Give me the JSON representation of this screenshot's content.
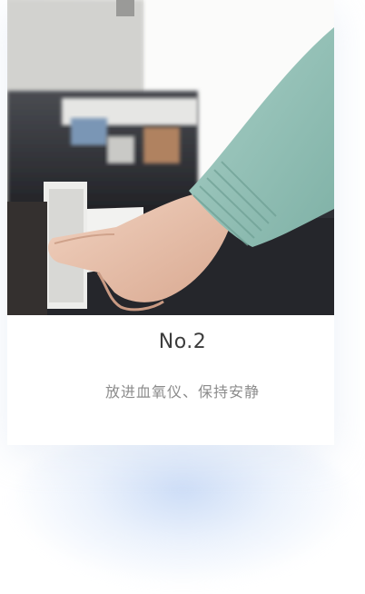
{
  "step": {
    "number_label": "No.2",
    "description": "放进血氧仪、保持安静"
  },
  "photo": {
    "subject": "finger-inserted-into-pulse-oximeter-icon"
  },
  "colors": {
    "title": "#3c3c3c",
    "subtitle": "#8c8c8c",
    "sleeve": "#8fbcb3",
    "glow": "#c4d7f5"
  }
}
